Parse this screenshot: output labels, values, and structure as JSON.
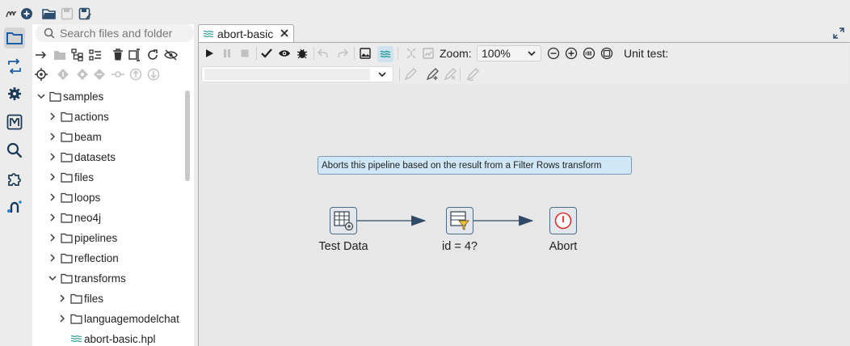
{
  "explorer": {
    "search_placeholder": "Search files and folder",
    "tree": [
      {
        "label": "samples",
        "level": 0,
        "expanded": true,
        "kind": "folder"
      },
      {
        "label": "actions",
        "level": 1,
        "expanded": false,
        "kind": "folder"
      },
      {
        "label": "beam",
        "level": 1,
        "expanded": false,
        "kind": "folder"
      },
      {
        "label": "datasets",
        "level": 1,
        "expanded": false,
        "kind": "folder"
      },
      {
        "label": "files",
        "level": 1,
        "expanded": false,
        "kind": "folder"
      },
      {
        "label": "loops",
        "level": 1,
        "expanded": false,
        "kind": "folder"
      },
      {
        "label": "neo4j",
        "level": 1,
        "expanded": false,
        "kind": "folder"
      },
      {
        "label": "pipelines",
        "level": 1,
        "expanded": false,
        "kind": "folder"
      },
      {
        "label": "reflection",
        "level": 1,
        "expanded": false,
        "kind": "folder"
      },
      {
        "label": "transforms",
        "level": 1,
        "expanded": true,
        "kind": "folder"
      },
      {
        "label": "files",
        "level": 2,
        "expanded": false,
        "kind": "folder"
      },
      {
        "label": "languagemodelchat",
        "level": 2,
        "expanded": false,
        "kind": "folder"
      },
      {
        "label": "abort-basic.hpl",
        "level": 2,
        "expanded": false,
        "kind": "pipeline-file"
      }
    ]
  },
  "editor": {
    "tab_label": "abort-basic",
    "zoom_label": "Zoom:",
    "zoom_value": "100%",
    "unit_test_label": "Unit test:"
  },
  "canvas": {
    "note": "Aborts this pipeline based on the result from a Filter Rows transform",
    "transforms": [
      {
        "id": "test-data",
        "label": "Test Data",
        "icon": "data-grid-icon"
      },
      {
        "id": "filter",
        "label": "id = 4?",
        "icon": "filter-rows-icon"
      },
      {
        "id": "abort",
        "label": "Abort",
        "icon": "abort-icon"
      }
    ]
  },
  "colors": {
    "accent": "#2d6ea8",
    "note_background": "#cfe7f7",
    "hop": "#2e4a66",
    "abort_red": "#d9312b",
    "filter_yellow": "#f2c23a"
  }
}
